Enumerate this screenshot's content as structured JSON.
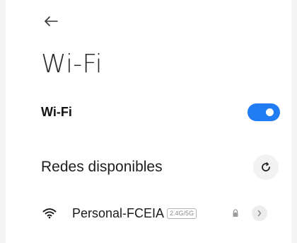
{
  "header": {
    "back_icon": "arrow-left-icon",
    "title": "Wi-Fi"
  },
  "wifi_toggle": {
    "label": "Wi-Fi",
    "enabled": true,
    "accent_color": "#1f7cf2"
  },
  "available_networks": {
    "label": "Redes disponibles",
    "refresh_icon": "refresh-icon",
    "networks": [
      {
        "name": "Personal-FCEIA",
        "band_badge": "2.4G/5G",
        "signal_icon": "wifi-signal-icon",
        "secured": true,
        "lock_icon": "lock-icon",
        "detail_icon": "chevron-right-icon"
      }
    ]
  }
}
